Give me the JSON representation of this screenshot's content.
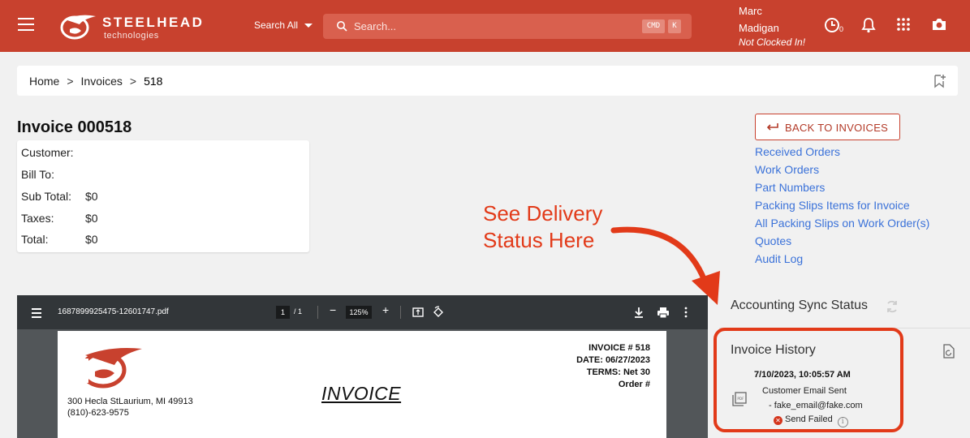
{
  "header": {
    "brand_name": "STEELHEAD",
    "brand_sub": "technologies",
    "search_scope": "Search All",
    "search_placeholder": "Search...",
    "shortcut_key1": "CMD",
    "shortcut_key2": "K",
    "user_first": "Marc",
    "user_last": "Madigan",
    "clock_status": "Not Clocked In!",
    "clock_badge": "0",
    "colors": {
      "bar": "#c8412e",
      "search_bg": "#d9604e"
    }
  },
  "breadcrumb": {
    "home": "Home",
    "section": "Invoices",
    "current": "518"
  },
  "invoice": {
    "title": "Invoice 000518",
    "fields": [
      {
        "label": "Customer:",
        "value": ""
      },
      {
        "label": "Bill To:",
        "value": ""
      },
      {
        "label": "Sub Total:",
        "value": "$0"
      },
      {
        "label": "Taxes:",
        "value": "$0"
      },
      {
        "label": "Total:",
        "value": "$0"
      }
    ]
  },
  "side": {
    "back_label": "BACK TO INVOICES",
    "links": [
      "Received Orders",
      "Work Orders",
      "Part Numbers",
      "Packing Slips Items for Invoice",
      "All Packing Slips on Work Order(s)",
      "Quotes",
      "Audit Log"
    ],
    "accounting_title": "Accounting Sync Status",
    "history_title": "Invoice History",
    "history": {
      "date": "7/10/2023, 10:05:57 AM",
      "event": "Customer Email Sent",
      "email": "- fake_email@fake.com",
      "status": "Send Failed"
    }
  },
  "annotation": {
    "line1": "See Delivery",
    "line2": "Status Here",
    "color": "#e23a19"
  },
  "pdf": {
    "filename": "1687899925475-12601747.pdf",
    "page": "1",
    "page_total": "/ 1",
    "zoom": "125%",
    "address_line1": "300 Hecla StLaurium, MI 49913",
    "address_line2": "(810)-623-9575",
    "doc_title": "INVOICE",
    "invoice_no": "INVOICE # 518",
    "date": "DATE: 06/27/2023",
    "terms": "TERMS: Net 30",
    "order": "Order #"
  }
}
